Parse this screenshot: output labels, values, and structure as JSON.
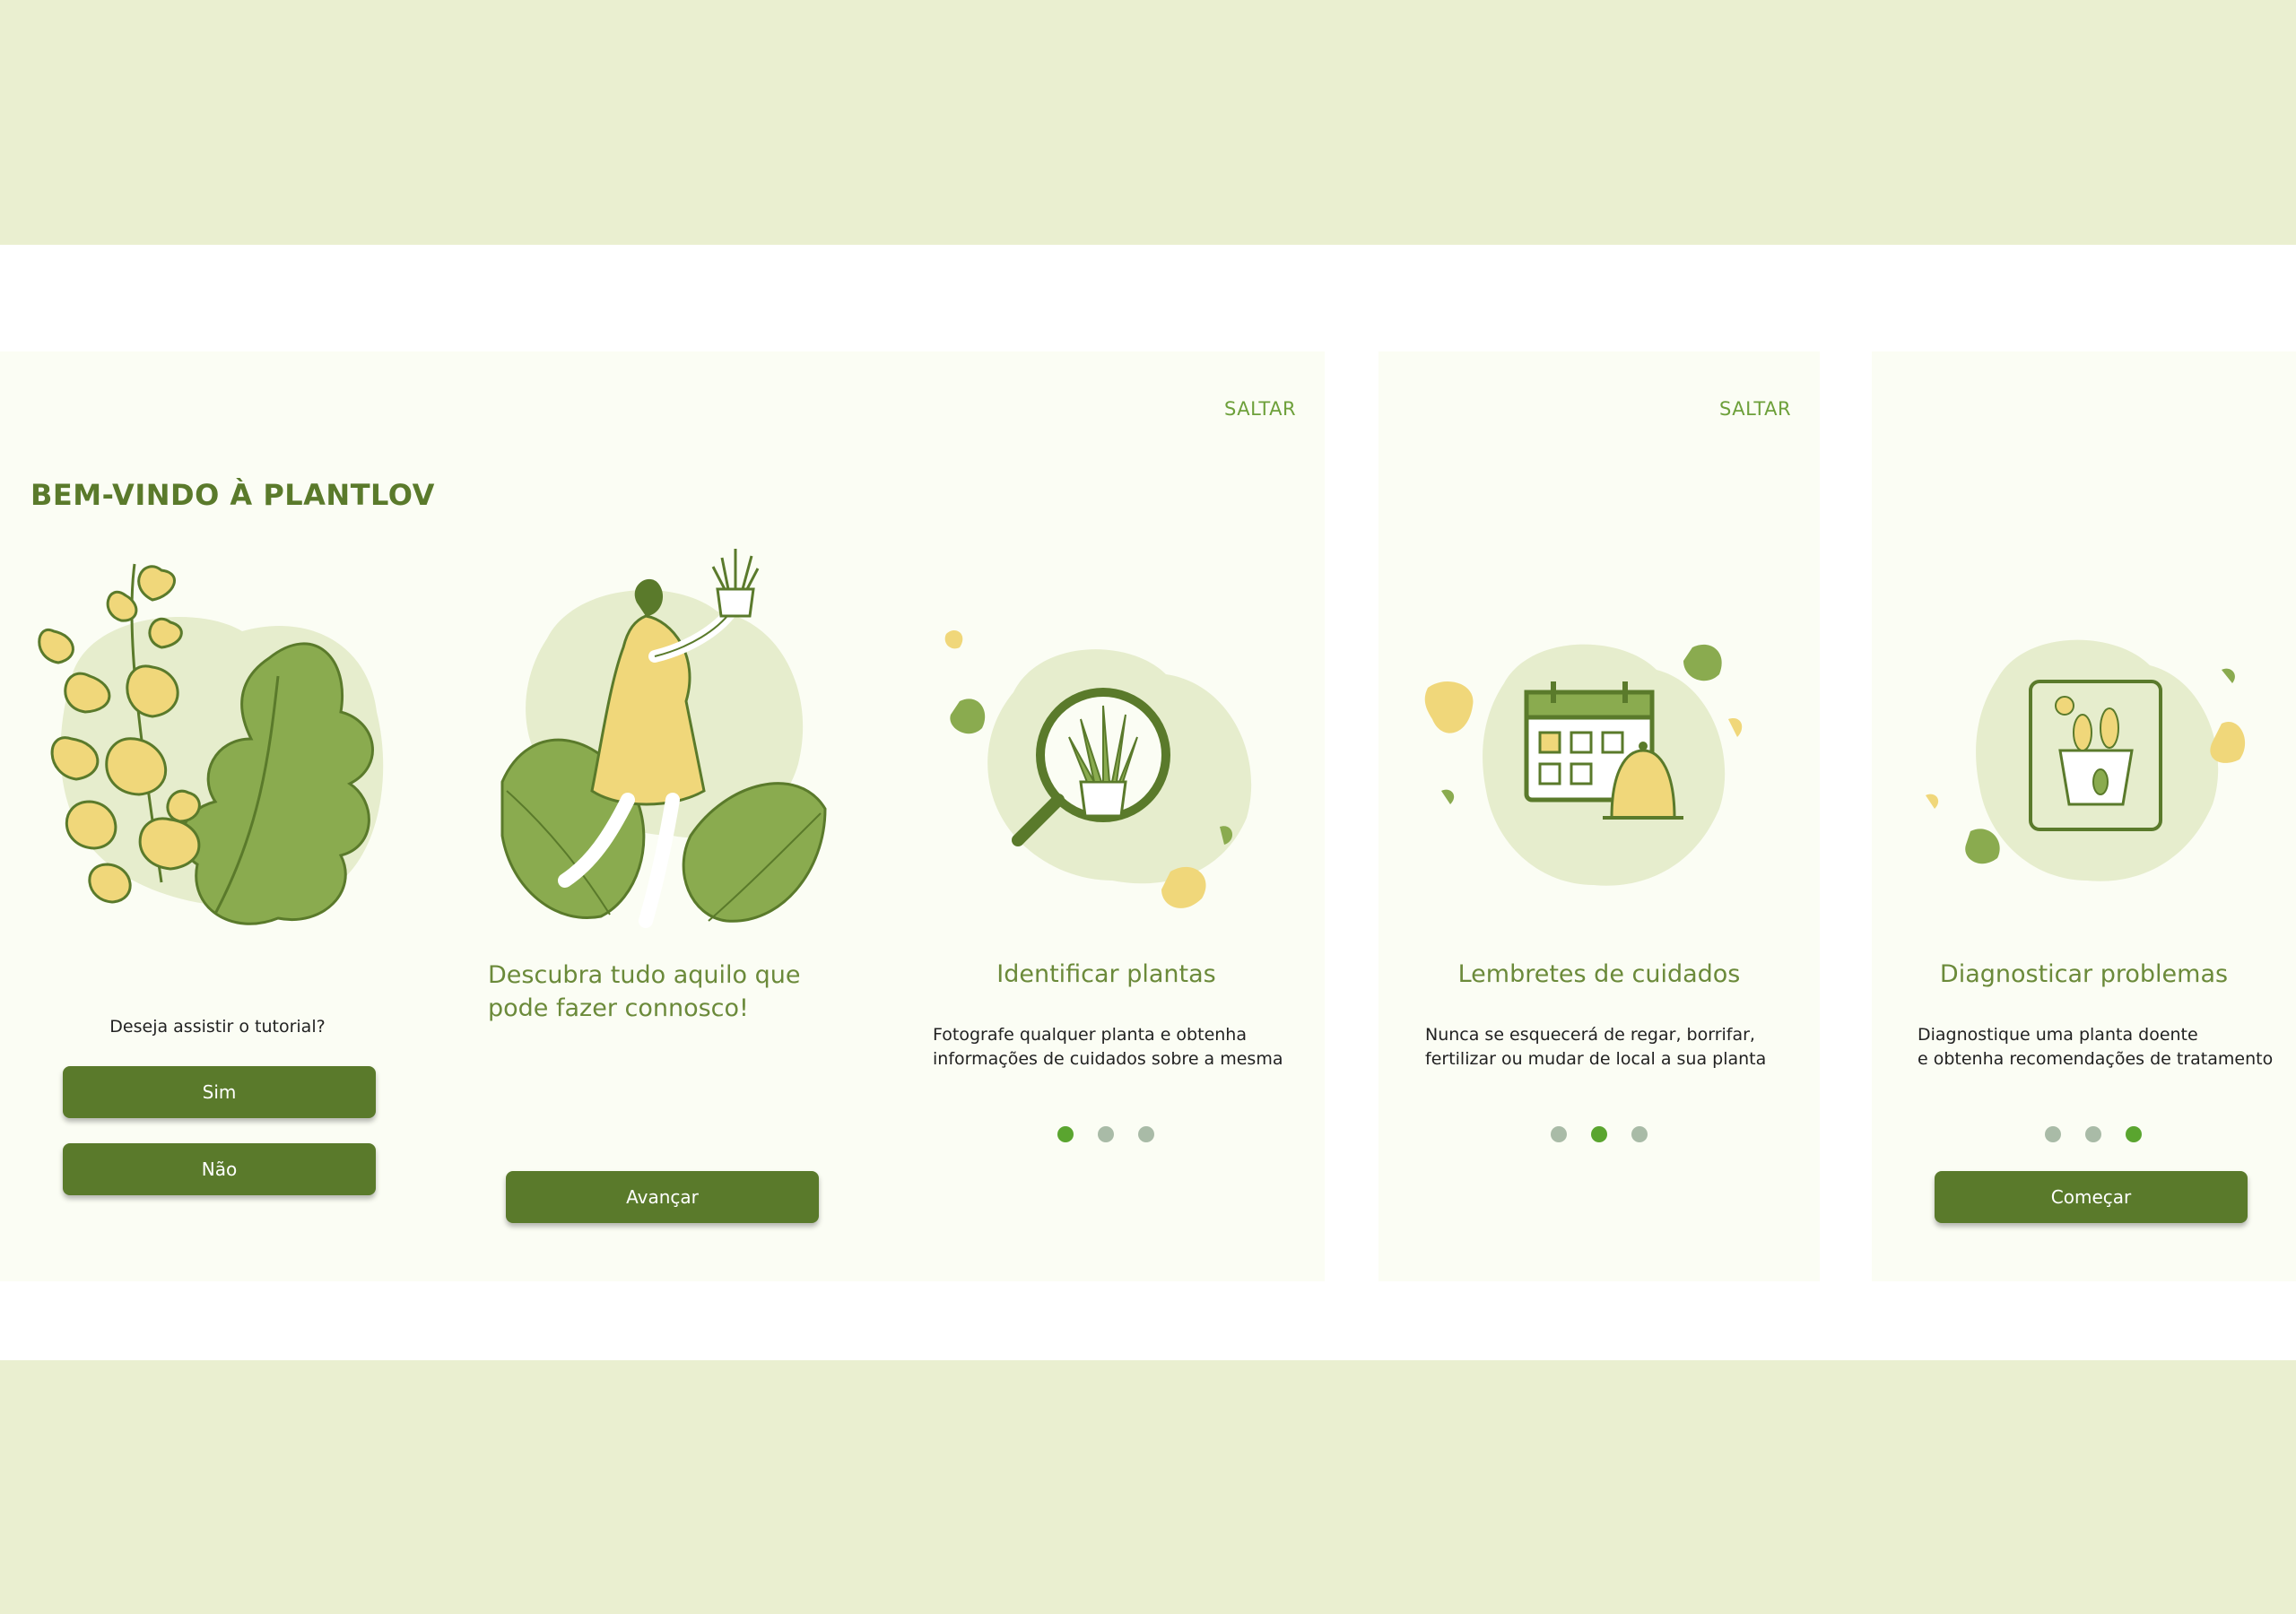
{
  "screens": {
    "welcome": {
      "heading": "BEM-VINDO À PLANTLOVE",
      "question": "Deseja assistir o tutorial?",
      "yes_label": "Sim",
      "no_label": "Não"
    },
    "discover": {
      "title": "Descubra tudo aquilo que pode fazer connosco!",
      "next_label": "Avançar"
    },
    "identify": {
      "skip_label": "SALTAR",
      "title": "Identificar plantas",
      "desc_line1": "Fotografe qualquer planta e obtenha",
      "desc_line2": "informações de cuidados sobre a mesma",
      "active_dot": 1
    },
    "reminders": {
      "skip_label": "SALTAR",
      "title": "Lembretes de cuidados",
      "desc_line1": "Nunca se esquecerá de regar, borrifar,",
      "desc_line2": "fertilizar ou mudar de local a sua planta",
      "active_dot": 2
    },
    "diagnose": {
      "title": "Diagnosticar problemas",
      "desc_line1": "Diagnostique uma planta doente",
      "desc_line2": "e obtenha recomendações de tratamento",
      "start_label": "Começar",
      "active_dot": 3
    }
  },
  "colors": {
    "primary": "#5a7a2b",
    "accent_green": "#8aab4f",
    "accent_yellow": "#f0d77a",
    "blob": "#e6edcd",
    "dot_active": "#5aa52f",
    "dot_inactive": "#a9bba7",
    "background": "#eaefd0"
  },
  "icons": [
    "plant-leaves-illustration",
    "woman-holding-plant-illustration",
    "magnifier-plant-icon",
    "calendar-bell-icon",
    "sick-plant-icon"
  ]
}
